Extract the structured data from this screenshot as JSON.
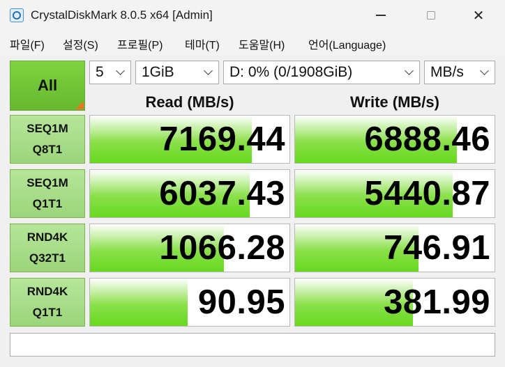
{
  "window": {
    "title": "CrystalDiskMark 8.0.5 x64 [Admin]"
  },
  "title_controls": {
    "minimize": "minimize-icon",
    "maximize": "maximize-icon",
    "close": "close-icon",
    "close_glyph": "✕"
  },
  "menu": [
    {
      "label": "파일(F)"
    },
    {
      "label": "설정(S)"
    },
    {
      "label": "프로필(P)"
    },
    {
      "label": "테마(T)"
    },
    {
      "label": "도움말(H)"
    },
    {
      "label": "언어(Language)"
    }
  ],
  "controls": {
    "all_label": "All",
    "count": "5",
    "size": "1GiB",
    "drive": "D: 0% (0/1908GiB)",
    "unit": "MB/s"
  },
  "headers": {
    "read": "Read (MB/s)",
    "write": "Write (MB/s)"
  },
  "tests": [
    {
      "line1": "SEQ1M",
      "line2": "Q8T1",
      "read": "7169.44",
      "write": "6888.46",
      "read_fill": 0.81,
      "write_fill": 0.81
    },
    {
      "line1": "SEQ1M",
      "line2": "Q1T1",
      "read": "6037.43",
      "write": "5440.87",
      "read_fill": 0.8,
      "write_fill": 0.79
    },
    {
      "line1": "RND4K",
      "line2": "Q32T1",
      "read": "1066.28",
      "write": "746.91",
      "read_fill": 0.67,
      "write_fill": 0.62
    },
    {
      "line1": "RND4K",
      "line2": "Q1T1",
      "read": "90.95",
      "write": "381.99",
      "read_fill": 0.49,
      "write_fill": 0.59
    }
  ],
  "comment": ""
}
